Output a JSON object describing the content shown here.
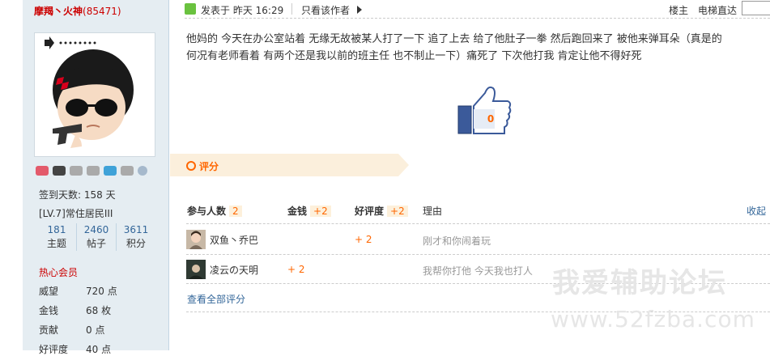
{
  "profile": {
    "username": "摩羯丶火神",
    "uid": "(85471)",
    "signin": "签到天数: 158 天",
    "level": "[LV.7]常住居民III",
    "stats": [
      {
        "num": "181",
        "label": "主题"
      },
      {
        "num": "2460",
        "label": "帖子"
      },
      {
        "num": "3611",
        "label": "积分"
      }
    ],
    "group": "热心会员",
    "attrs": [
      {
        "label": "威望",
        "value": "720 点"
      },
      {
        "label": "金钱",
        "value": "68 枚"
      },
      {
        "label": "贡献",
        "value": "0 点"
      },
      {
        "label": "好评度",
        "value": "40 点"
      }
    ]
  },
  "post": {
    "time": "发表于 昨天 16:29",
    "only_author": "只看该作者",
    "floor": "楼主",
    "jump": "电梯直达",
    "content_line1": "他妈的  今天在办公室站着  无缘无故被某人打了一下  追了上去 给了他肚子一拳 然后跑回来了  被他来弹耳朵（真是的",
    "content_line2": "何况有老师看着  有两个还是我以前的班主任  也不制止一下）痛死了  下次他打我  肯定让他不得好死",
    "like_count": "0"
  },
  "rating": {
    "title": "评分",
    "headers": {
      "participants": "参与人数",
      "participants_count": "2",
      "money": "金钱",
      "money_total": "+2",
      "reputation": "好评度",
      "reputation_total": "+2",
      "reason": "理由",
      "collapse": "收起"
    },
    "rows": [
      {
        "name": "双鱼丶乔巴",
        "money": "",
        "reputation": "+ 2",
        "reason": "刚才和你闹着玩"
      },
      {
        "name": "凌云の天明",
        "money": "+ 2",
        "reputation": "",
        "reason": "我帮你打他 今天我也打人"
      }
    ],
    "view_all": "查看全部评分"
  },
  "watermark": {
    "line1": "我爱辅助论坛",
    "line2": "www.52fzba.com"
  },
  "colors": {
    "accent_orange": "#ff6600",
    "username_red": "#cc0000",
    "link_blue": "#336699",
    "sidebar_bg": "#e5edf2"
  },
  "icons": [
    "post-icon",
    "triangle-right-icon",
    "thumbs-up-icon",
    "circle-icon",
    "medal-icon",
    "help-icon"
  ]
}
